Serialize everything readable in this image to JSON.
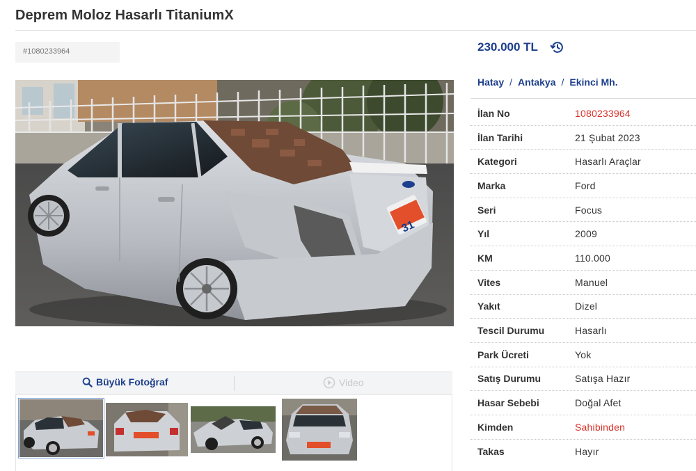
{
  "listing": {
    "title": "Deprem Moloz Hasarlı TitaniumX",
    "id_label": "#1080233964",
    "price": "230.000 TL"
  },
  "location": {
    "city": "Hatay",
    "district": "Antakya",
    "neighborhood": "Ekinci Mh.",
    "separator": "/"
  },
  "media": {
    "big_photo_label": "Büyük Fotoğraf",
    "video_label": "Video",
    "plate_text": "31",
    "photo_alt": "Damaged silver Ford Focus sedan with rubble on rear",
    "thumbnail_count": 4
  },
  "details": [
    {
      "label": "İlan No",
      "value": "1080233964",
      "highlight": true
    },
    {
      "label": "İlan Tarihi",
      "value": "21 Şubat 2023",
      "highlight": false
    },
    {
      "label": "Kategori",
      "value": "Hasarlı Araçlar",
      "highlight": false
    },
    {
      "label": "Marka",
      "value": "Ford",
      "highlight": false
    },
    {
      "label": "Seri",
      "value": "Focus",
      "highlight": false
    },
    {
      "label": "Yıl",
      "value": "2009",
      "highlight": false
    },
    {
      "label": "KM",
      "value": "110.000",
      "highlight": false
    },
    {
      "label": "Vites",
      "value": "Manuel",
      "highlight": false
    },
    {
      "label": "Yakıt",
      "value": "Dizel",
      "highlight": false
    },
    {
      "label": "Tescil Durumu",
      "value": "Hasarlı",
      "highlight": false
    },
    {
      "label": "Park Ücreti",
      "value": "Yok",
      "highlight": false
    },
    {
      "label": "Satış Durumu",
      "value": "Satışa Hazır",
      "highlight": false
    },
    {
      "label": "Hasar Sebebi",
      "value": "Doğal Afet",
      "highlight": false
    },
    {
      "label": "Kimden",
      "value": "Sahibinden",
      "highlight": true
    },
    {
      "label": "Takas",
      "value": "Hayır",
      "highlight": false
    }
  ],
  "colors": {
    "accent": "#1d3f8c",
    "highlight": "#d9312a",
    "text": "#333333"
  },
  "icons": {
    "history": "history-icon",
    "search": "search-icon",
    "play": "play-icon"
  }
}
